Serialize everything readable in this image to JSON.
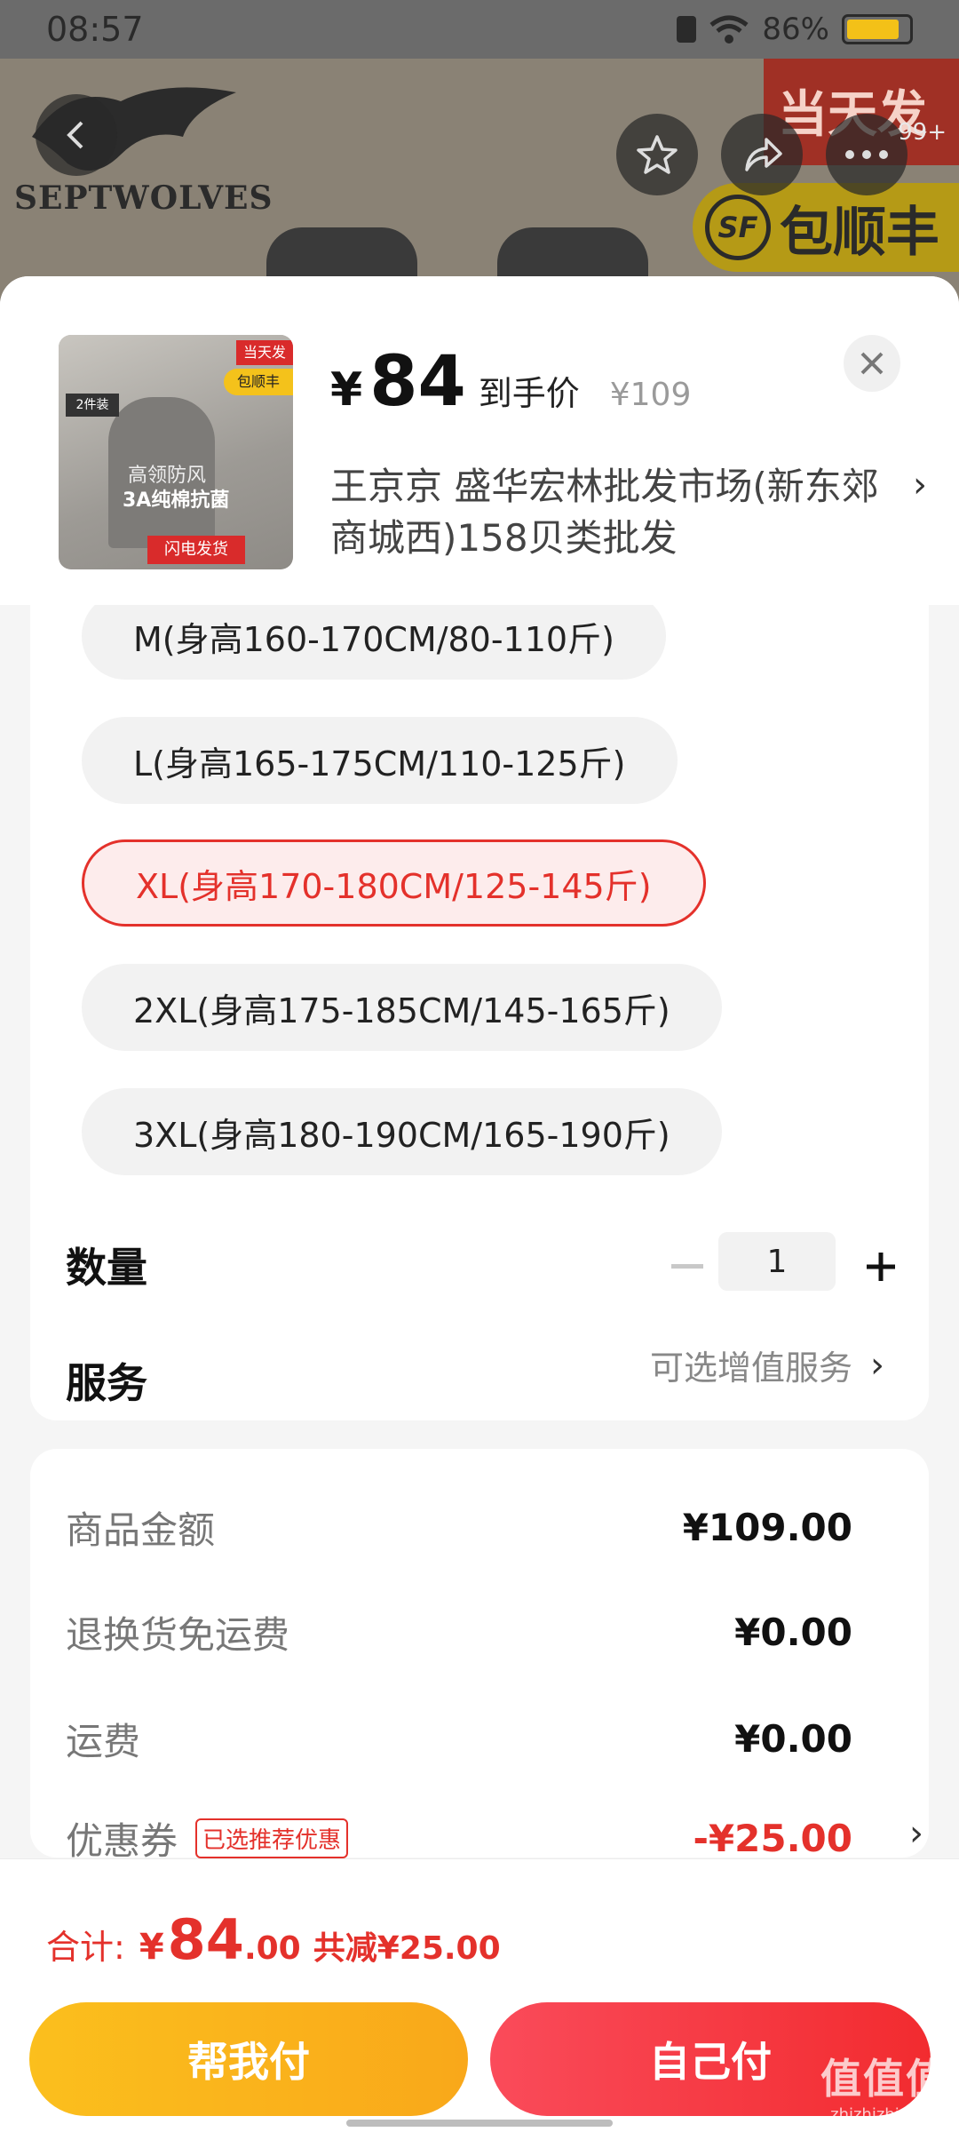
{
  "status_bar": {
    "time": "08:57",
    "battery": "86%",
    "battery_level": 0.86
  },
  "header": {
    "brand": "SEPTWOLVES",
    "promo_same_day": "当天发",
    "sf_label": "包顺丰",
    "sf_badge": "SF",
    "cart_count": "99+"
  },
  "product": {
    "price_yen": "¥",
    "price": "84",
    "price_label": "到手价",
    "original_price": "¥109",
    "store": "王京京  盛华宏林批发市场(新东郊商城西)158贝类批发",
    "thumb_tags": {
      "top": "当天发",
      "sf": "包顺丰",
      "pack": "2件装",
      "line1": "高领防风",
      "line2": "3A纯棉抗菌",
      "bottom": "闪电发货"
    }
  },
  "sizes": [
    {
      "label": "M(身高160-170CM/80-110斤)"
    },
    {
      "label": "L(身高165-175CM/110-125斤)"
    },
    {
      "label": "XL(身高170-180CM/125-145斤)"
    },
    {
      "label": "2XL(身高175-185CM/145-165斤)"
    },
    {
      "label": "3XL(身高180-190CM/165-190斤)"
    }
  ],
  "selected_size": "XL(身高170-180CM/125-145斤)",
  "quantity": {
    "label": "数量",
    "value": "1"
  },
  "service": {
    "label": "服务",
    "value": "可选增值服务"
  },
  "amounts": {
    "goods_label": "商品金额",
    "goods_value": "¥109.00",
    "return_label": "退换货免运费",
    "return_value": "¥0.00",
    "shipping_label": "运费",
    "shipping_value": "¥0.00",
    "coupon_label": "优惠券",
    "coupon_tag": "已选推荐优惠",
    "coupon_value": "-¥25.00"
  },
  "footer": {
    "total_label": "合计:",
    "total_yen": "¥",
    "total_int": "84",
    "total_dec": ".00",
    "discount": "共减¥25.00",
    "help_pay": "帮我付",
    "self_pay": "自己付"
  },
  "watermark": {
    "big": "值值值",
    "small": "zhizhizhi.com"
  },
  "colors": {
    "accent_red": "#e4312b",
    "button_yellow": "#fbbf1d",
    "button_red": "#f22b2f"
  }
}
